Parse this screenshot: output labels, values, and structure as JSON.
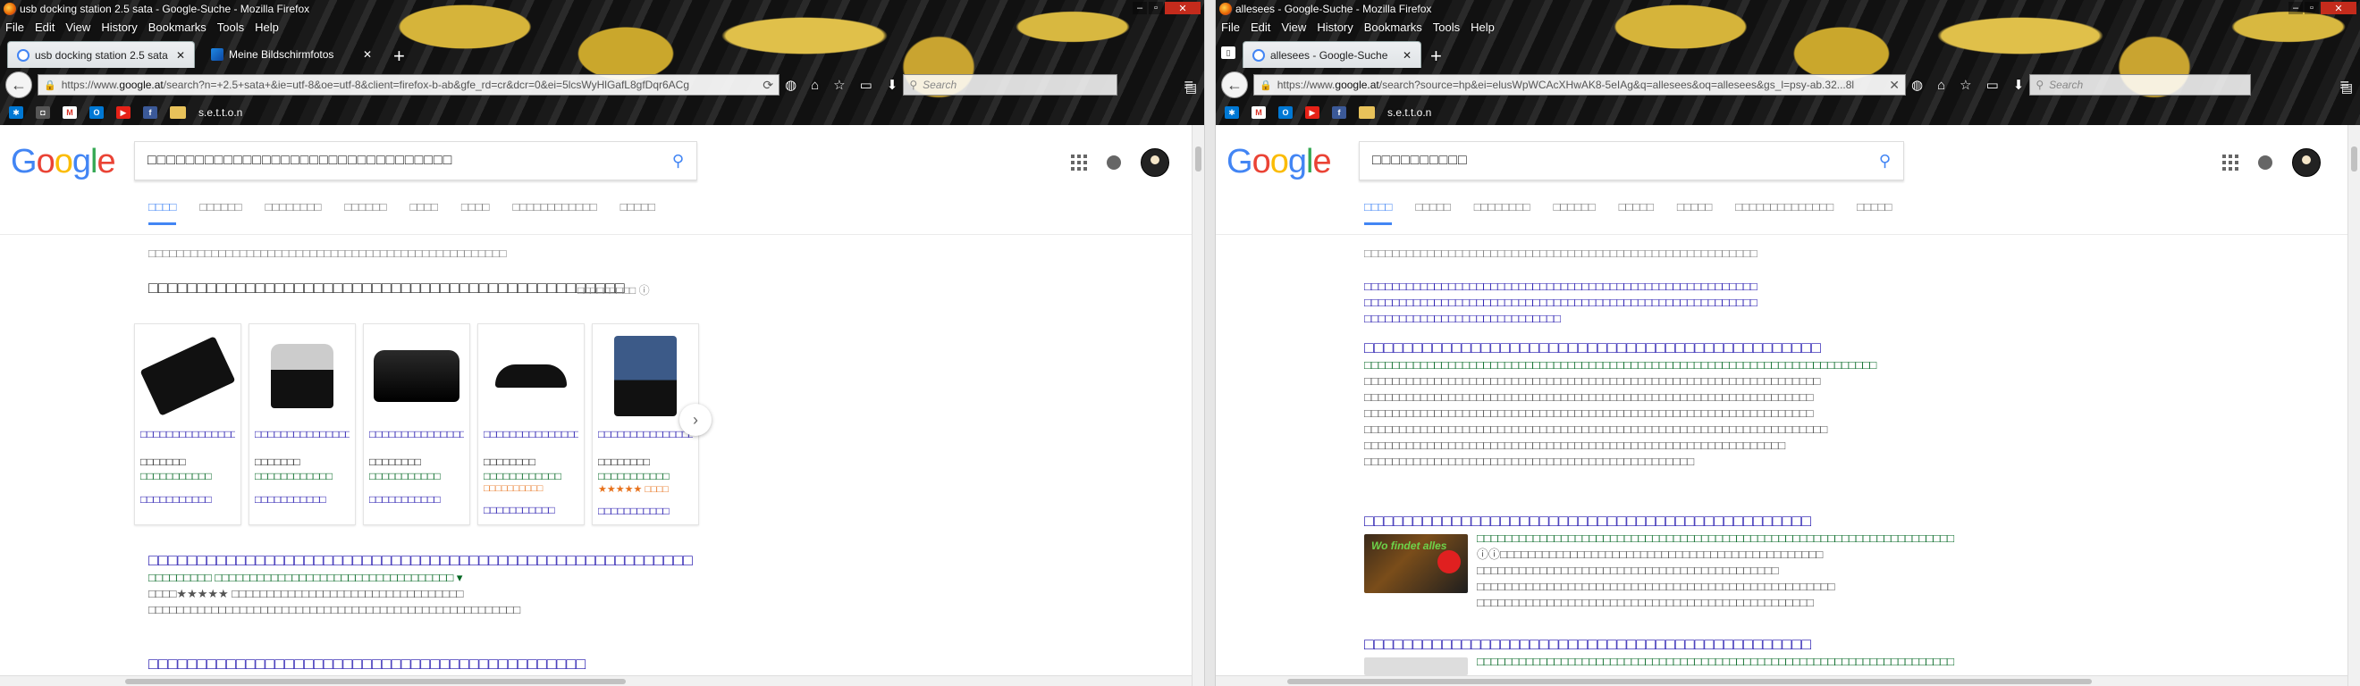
{
  "colors": {
    "link": "#1a0dab",
    "url": "#006621",
    "snippet": "#545454",
    "accent": "#4285f4"
  },
  "left": {
    "window_title": "usb docking station 2.5 sata - Google-Suche - Mozilla Firefox",
    "menu": [
      "File",
      "Edit",
      "View",
      "History",
      "Bookmarks",
      "Tools",
      "Help"
    ],
    "tabs": [
      {
        "label": "usb docking station 2.5 sata",
        "icon": "google-icon"
      },
      {
        "label": "Meine Bildschirmfotos",
        "icon": "k-icon"
      }
    ],
    "url_prefix": "https://www.",
    "url_domain": "google.at",
    "url_rest": "/search?n=+2.5+sata+&ie=utf-8&oe=utf-8&client=firefox-b-ab&gfe_rd=cr&dcr=0&ei=5lcsWyHlGafL8gfDqr6ACg",
    "search_placeholder": "Search",
    "bookmarks": [
      "s.e.t.t.o.n"
    ],
    "google_logo": [
      "G",
      "o",
      "o",
      "g",
      "l",
      "e"
    ],
    "query": "□□□□□□□□□□□□□□□□□□□□□□□□□□□□□□□□",
    "google_tabs": [
      "□□□□",
      "□□□□□□",
      "□□□□□□□□",
      "□□□□□□",
      "□□□□",
      "□□□□",
      "□□□□□□□□□□□□",
      "□□□□□"
    ],
    "stats": "□□□□□□□□□□□□□□□□□□□□□□□□□□□□□□□□□□□□□□□□□□□□□□□□□□□",
    "shopping_heading": "□□□□□□□□□□□□□□□□□□□□□□□□□□□□□□□□□□□□□□□□□□□□□□□□□",
    "sponsored": "□□□□□□□□□ ⓘ",
    "cards": [
      {
        "title": "□□□□□□□□□□□□□□□□",
        "price": "□□□□□□□",
        "store": "□□□□□□□□□□□",
        "rating": "",
        "extra": "□□□□□□□□□□□"
      },
      {
        "title": "□□□□□□□□□□□□□□□□□□",
        "price": "□□□□□□□",
        "store": "□□□□□□□□□□□□",
        "rating": "",
        "extra": "□□□□□□□□□□□"
      },
      {
        "title": "□□□□□□□□□□□□□□□□",
        "price": "□□□□□□□□",
        "store": "□□□□□□□□□□□",
        "rating": "",
        "extra": "□□□□□□□□□□□"
      },
      {
        "title": "□□□□□□□□□□□□□□□□□□",
        "price": "□□□□□□□□",
        "store": "□□□□□□□□□□□□",
        "rating": "□□□□□□□□□□",
        "extra": "□□□□□□□□□□□"
      },
      {
        "title": "□□□□□□□□□□□□□□□□",
        "price": "□□□□□□□□",
        "store": "□□□□□□□□□□□",
        "rating": "★★★★★ □□□□",
        "extra": "□□□□□□□□□□□"
      }
    ],
    "results": [
      {
        "title": "□□□□□□□□□□□□□□□□□□□□□□□□□□□□□□□□□□□□□□□□□□□□□□□□□□□□□□□□",
        "url": "□□□□□□□□□ □□□□□□□□□□□□□□□□□□□□□□□□□□□□□□□□□□ ▾",
        "rating": "□□□□★★★★★ □□□□□□□□□□□□□□□□□□□□□□□□□□□□□□□□□",
        "snippet": "□□□□□□□□□□□□□□□□□□□□□□□□□□□□□□□□□□□□□□□□□□□□□□□□□□□□□"
      },
      {
        "title": "□□□□□□□□□□□□□□□□□□□□□□□□□□□□□□□□□□□□□□□□□□□□□"
      }
    ]
  },
  "right": {
    "window_title": "allesees - Google-Suche - Mozilla Firefox",
    "menu": [
      "File",
      "Edit",
      "View",
      "History",
      "Bookmarks",
      "Tools",
      "Help"
    ],
    "tabs": [
      {
        "label": "allesees - Google-Suche",
        "icon": "google-icon"
      }
    ],
    "url_prefix": "https://www.",
    "url_domain": "google.at",
    "url_rest": "/search?source=hp&ei=elusWpWCAcXHwAK8-5eIAg&q=allesees&oq=allesees&gs_l=psy-ab.32...8l",
    "search_placeholder": "Search",
    "bookmarks": [
      "s.e.t.t.o.n"
    ],
    "google_logo": [
      "G",
      "o",
      "o",
      "g",
      "l",
      "e"
    ],
    "query": "□□□□□□□□□□",
    "google_tabs": [
      "□□□□",
      "□□□□□",
      "□□□□□□□□",
      "□□□□□□",
      "□□□□□",
      "□□□□□",
      "□□□□□□□□□□□□□□",
      "□□□□□"
    ],
    "stats": "□□□□□□□□□□□□□□□□□□□□□□□□□□□□□□□□□□□□□□□□□□□□□□□□□□□□□□□□",
    "did_you_mean": {
      "line1": "□□□□□□□□□□□□□□□□□□□□□□□□□□□□□□□□□□□□□□□□□□□□□□□□□□□□□□□□",
      "line2": "□□□□□□□□□□□□□□□□□□□□□□□□□□□□□□□□□□□□□□□□□□□□□□□□□□□□□□□□",
      "line3": "□□□□□□□□□□□□□□□□□□□□□□□□□□□□"
    },
    "results": [
      {
        "title": "□□□□□□□□□□□□□□□□□□□□□□□□□□□□□□□□□□□□□□□□□□□□□□□",
        "url": "□□□□□□□□□□□□□□□□□□□□□□□□□□□□□□□□□□□□□□□□□□□□□□□□□□□□□□□□□□□□□□□□□□□□□□□□□",
        "snippet": [
          "□□□□□□□□□□□□□□□□□□□□□□□□□□□□□□□□□□□□□□□□□□□□□□□□□□□□□□□□□□□□□□□□□",
          "□□□□□□□□□□□□□□□□□□□□□□□□□□□□□□□□□□□□□□□□□□□□□□□□□□□□□□□□□□□□□□□□",
          "□□□□□□□□□□□□□□□□□□□□□□□□□□□□□□□□□□□□□□□□□□□□□□□□□□□□□□□□□□□□□□□□",
          "□□□□□□□□□□□□□□□□□□□□□□□□□□□□□□□□□□□□□□□□□□□□□□□□□□□□□□□□□□□□□□□□□□",
          "□□□□□□□□□□□□□□□□□□□□□□□□□□□□□□□□□□□□□□□□□□□□□□□□□□□□□□□□□□□□",
          "□□□□□□□□□□□□□□□□□□□□□□□□□□□□□□□□□□□□□□□□□□□□□□□"
        ]
      },
      {
        "title": "□□□□□□□□□□□□□□□□□□□□□□□□□□□□□□□□□□□□□□□□□□□□□□",
        "url": "□□□□□□□□□□□□□□□□□□□□□□□□□□□□□□□□□□□□□□□□□□□□□□□□□□□□□□□□□□□□□□□□□□□□",
        "thumb_text": "Wo findet alles",
        "snippet": [
          "ⓘⓘ□□□□□□□□□□□□□□□□□□□□□□□□□□□□□□□□□□□□□□□□□□□□□□",
          "□□□□□□□□□□□□□□□□□□□□□□□□□□□□□□□□□□□□□□□□□□□",
          "□□□□□□□□□□□□□□□□□□□□□□□□□□□□□□□□□□□□□□□□□□□□□□□□□□□",
          "□□□□□□□□□□□□□□□□□□□□□□□□□□□□□□□□□□□□□□□□□□□□□□□□"
        ]
      },
      {
        "title": "□□□□□□□□□□□□□□□□□□□□□□□□□□□□□□□□□□□□□□□□□□□□□□",
        "url": "□□□□□□□□□□□□□□□□□□□□□□□□□□□□□□□□□□□□□□□□□□□□□□□□□□□□□□□□□□□□□□□□□□□□"
      }
    ]
  }
}
